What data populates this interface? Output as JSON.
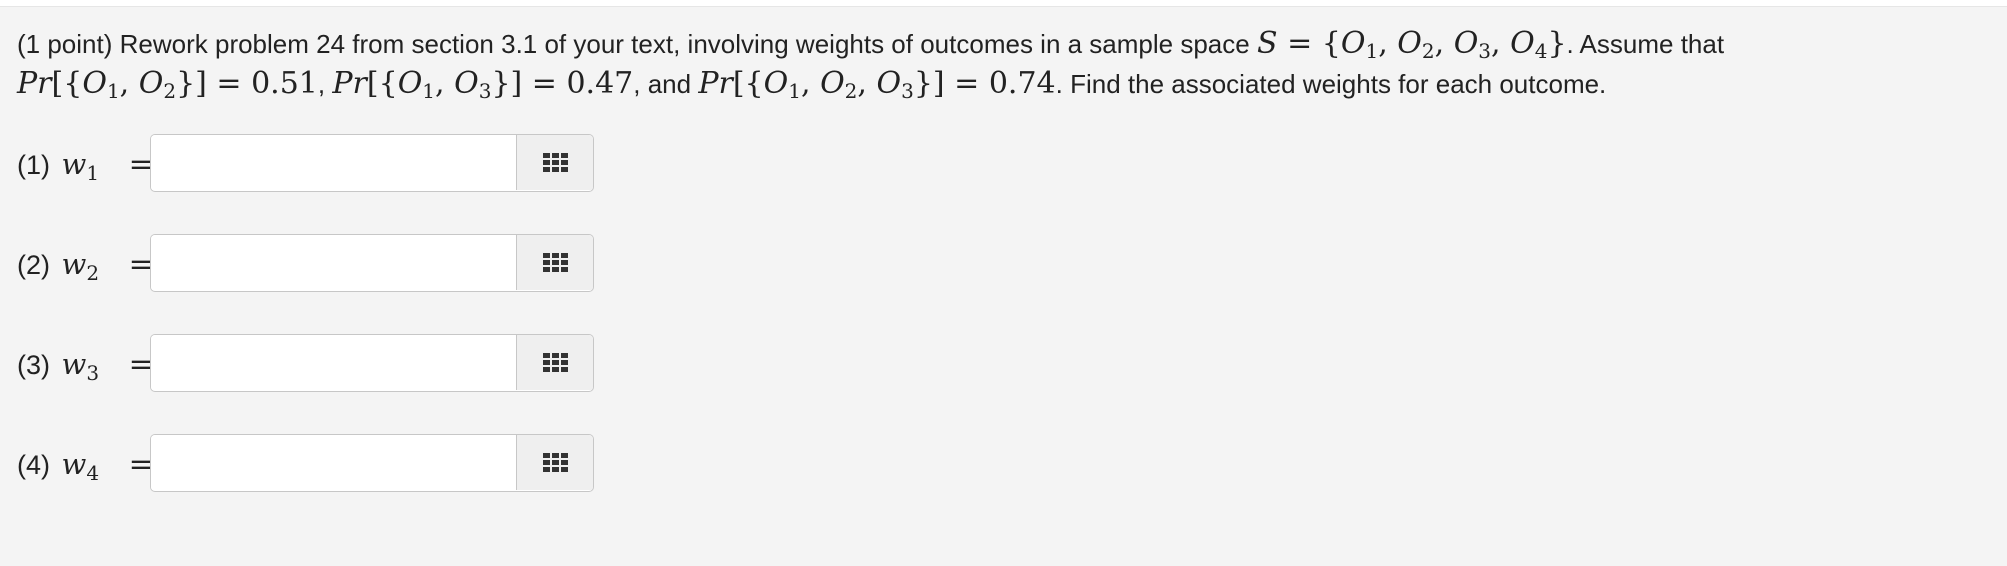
{
  "problem": {
    "points": "(1 point)",
    "text_before_set": "Rework problem 24 from section 3.1 of your text, involving weights of outcomes in a sample space",
    "set_symbol": "S",
    "equals": "=",
    "set_elements": [
      "O",
      "O",
      "O",
      "O"
    ],
    "set_subscripts": [
      "1",
      "2",
      "3",
      "4"
    ],
    "text_after_set": ". Assume that",
    "probabilities": [
      {
        "prefix": "Pr",
        "outcomes_subs": [
          "1",
          "2"
        ],
        "value": "0.51",
        "suffix": ","
      },
      {
        "prefix": "Pr",
        "outcomes_subs": [
          "1",
          "3"
        ],
        "value": "0.47",
        "suffix": ", and"
      },
      {
        "prefix": "Pr",
        "outcomes_subs": [
          "1",
          "2",
          "3"
        ],
        "value": "0.74",
        "suffix": "."
      }
    ],
    "text_end": "Find the associated weights for each outcome."
  },
  "answers": [
    {
      "number": "(1)",
      "var": "w",
      "sub": "1",
      "value": "",
      "placeholder": ""
    },
    {
      "number": "(2)",
      "var": "w",
      "sub": "2",
      "value": "",
      "placeholder": ""
    },
    {
      "number": "(3)",
      "var": "w",
      "sub": "3",
      "value": "",
      "placeholder": ""
    },
    {
      "number": "(4)",
      "var": "w",
      "sub": "4",
      "value": "",
      "placeholder": ""
    }
  ],
  "icons": {
    "picker": "grid-icon"
  }
}
